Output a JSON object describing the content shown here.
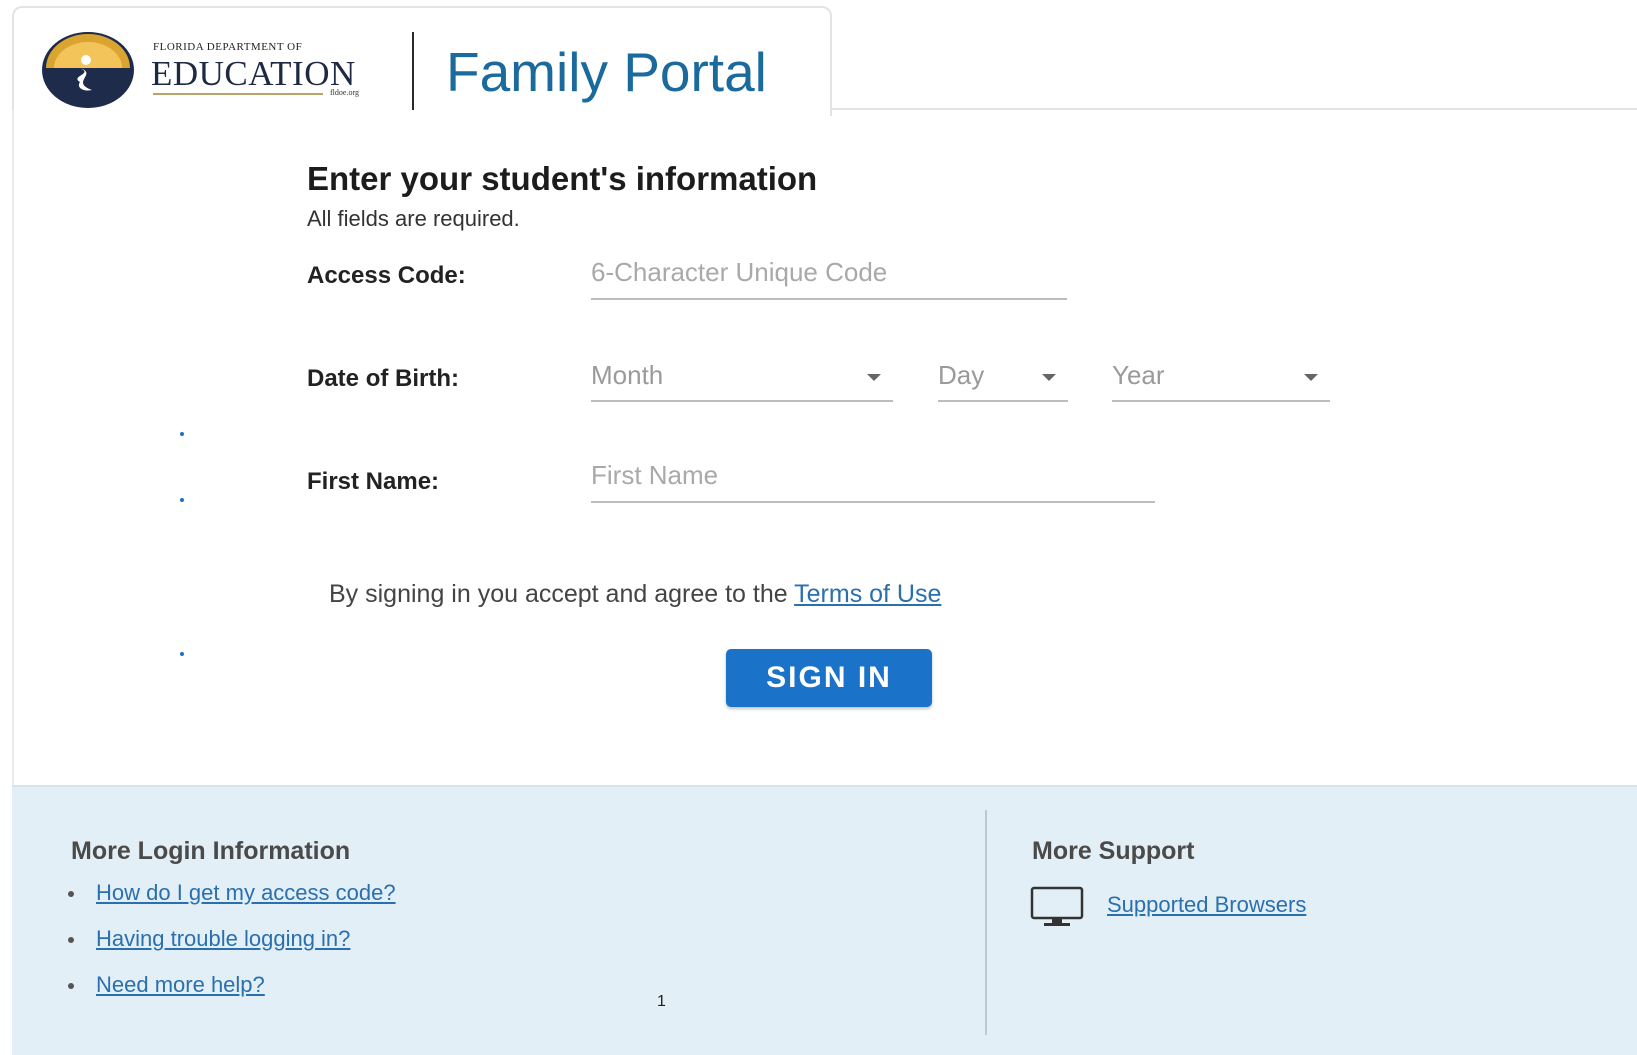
{
  "header": {
    "logo": {
      "small_text": "FLORIDA DEPARTMENT OF",
      "large_text": "EDUCATION",
      "url_text": "fldoe.org"
    },
    "portal_title": "Family Portal"
  },
  "form": {
    "heading": "Enter your student's information",
    "subheading": "All fields are required.",
    "access_code": {
      "label": "Access Code:",
      "placeholder": "6-Character Unique Code",
      "value": ""
    },
    "date_of_birth": {
      "label": "Date of Birth:",
      "month_placeholder": "Month",
      "day_placeholder": "Day",
      "year_placeholder": "Year"
    },
    "first_name": {
      "label": "First Name:",
      "placeholder": "First Name",
      "value": ""
    },
    "terms_prefix": "By signing in you accept and agree to the ",
    "terms_link": "Terms of Use",
    "submit_label": "SIGN IN"
  },
  "footer": {
    "login_info": {
      "heading": "More Login Information",
      "links": [
        "How do I get my access code?",
        "Having trouble logging in?",
        "Need more help?"
      ]
    },
    "support": {
      "heading": "More Support",
      "icon": "monitor-icon",
      "link": "Supported Browsers"
    }
  },
  "page_number": "1",
  "colors": {
    "accent": "#1a73c8",
    "title": "#1a6a9e",
    "link": "#2a6fae",
    "footer_bg": "#e3eff6"
  }
}
